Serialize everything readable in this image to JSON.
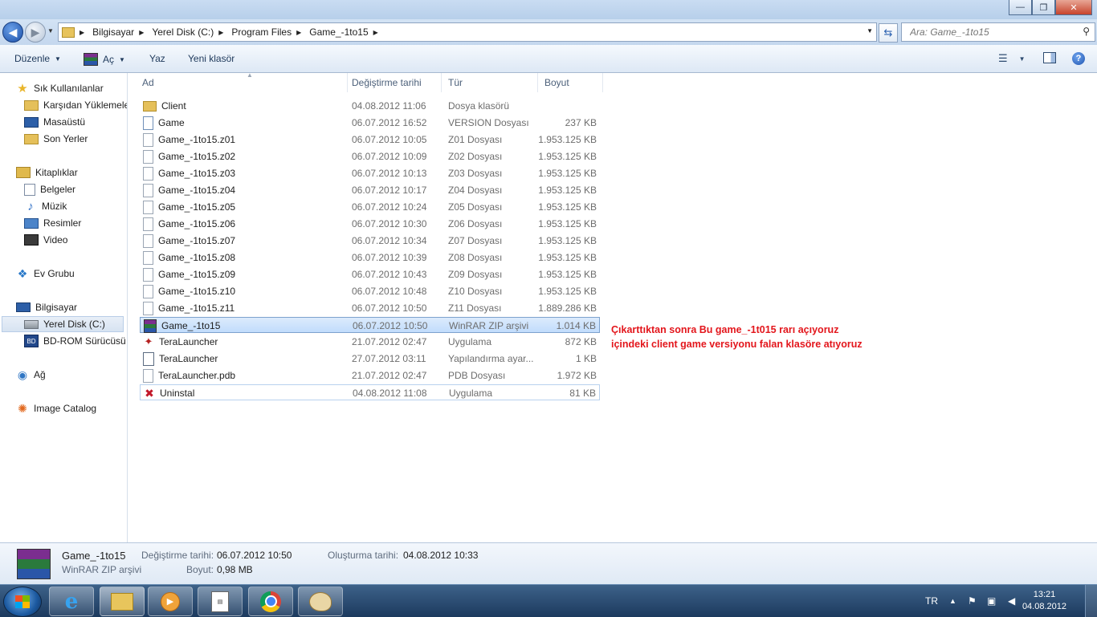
{
  "window": {
    "minimize": "—",
    "maximize": "❐",
    "close": "✕"
  },
  "address": {
    "crumbs": [
      "Bilgisayar",
      "Yerel Disk (C:)",
      "Program Files",
      "Game_-1to15"
    ],
    "search_placeholder": "Ara: Game_-1to15"
  },
  "toolbar": {
    "organize": "Düzenle",
    "open": "Aç",
    "burn": "Yaz",
    "new_folder": "Yeni klasör"
  },
  "nav": {
    "favorites": "Sık Kullanılanlar",
    "downloads": "Karşıdan Yüklemeler",
    "desktop": "Masaüstü",
    "recent": "Son Yerler",
    "libraries": "Kitaplıklar",
    "documents": "Belgeler",
    "music": "Müzik",
    "pictures": "Resimler",
    "videos": "Video",
    "homegroup": "Ev Grubu",
    "computer": "Bilgisayar",
    "local_disk": "Yerel Disk (C:)",
    "bd_rom": "BD-ROM Sürücüsü (",
    "network": "Ağ",
    "image_catalog": "Image Catalog"
  },
  "columns": {
    "name": "Ad",
    "date": "Değiştirme tarihi",
    "type": "Tür",
    "size": "Boyut"
  },
  "files": [
    {
      "name": "Client",
      "date": "04.08.2012 11:06",
      "type": "Dosya klasörü",
      "size": "",
      "icon": "folder-icon"
    },
    {
      "name": "Game",
      "date": "06.07.2012 16:52",
      "type": "VERSION Dosyası",
      "size": "237 KB",
      "icon": "version-file-icon"
    },
    {
      "name": "Game_-1to15.z01",
      "date": "06.07.2012 10:05",
      "type": "Z01 Dosyası",
      "size": "1.953.125 KB",
      "icon": "file-icon"
    },
    {
      "name": "Game_-1to15.z02",
      "date": "06.07.2012 10:09",
      "type": "Z02 Dosyası",
      "size": "1.953.125 KB",
      "icon": "file-icon"
    },
    {
      "name": "Game_-1to15.z03",
      "date": "06.07.2012 10:13",
      "type": "Z03 Dosyası",
      "size": "1.953.125 KB",
      "icon": "file-icon"
    },
    {
      "name": "Game_-1to15.z04",
      "date": "06.07.2012 10:17",
      "type": "Z04 Dosyası",
      "size": "1.953.125 KB",
      "icon": "file-icon"
    },
    {
      "name": "Game_-1to15.z05",
      "date": "06.07.2012 10:24",
      "type": "Z05 Dosyası",
      "size": "1.953.125 KB",
      "icon": "file-icon"
    },
    {
      "name": "Game_-1to15.z06",
      "date": "06.07.2012 10:30",
      "type": "Z06 Dosyası",
      "size": "1.953.125 KB",
      "icon": "file-icon"
    },
    {
      "name": "Game_-1to15.z07",
      "date": "06.07.2012 10:34",
      "type": "Z07 Dosyası",
      "size": "1.953.125 KB",
      "icon": "file-icon"
    },
    {
      "name": "Game_-1to15.z08",
      "date": "06.07.2012 10:39",
      "type": "Z08 Dosyası",
      "size": "1.953.125 KB",
      "icon": "file-icon"
    },
    {
      "name": "Game_-1to15.z09",
      "date": "06.07.2012 10:43",
      "type": "Z09 Dosyası",
      "size": "1.953.125 KB",
      "icon": "file-icon"
    },
    {
      "name": "Game_-1to15.z10",
      "date": "06.07.2012 10:48",
      "type": "Z10 Dosyası",
      "size": "1.953.125 KB",
      "icon": "file-icon"
    },
    {
      "name": "Game_-1to15.z11",
      "date": "06.07.2012 10:50",
      "type": "Z11 Dosyası",
      "size": "1.889.286 KB",
      "icon": "file-icon"
    },
    {
      "name": "Game_-1to15",
      "date": "06.07.2012 10:50",
      "type": "WinRAR ZIP arşivi",
      "size": "1.014 KB",
      "icon": "winrar-archive-icon"
    },
    {
      "name": "TeraLauncher",
      "date": "21.07.2012 02:47",
      "type": "Uygulama",
      "size": "872 KB",
      "icon": "launcher-app-icon"
    },
    {
      "name": "TeraLauncher",
      "date": "27.07.2012 03:11",
      "type": "Yapılandırma ayar...",
      "size": "1 KB",
      "icon": "config-file-icon"
    },
    {
      "name": "TeraLauncher.pdb",
      "date": "21.07.2012 02:47",
      "type": "PDB Dosyası",
      "size": "1.972 KB",
      "icon": "file-icon"
    },
    {
      "name": "Uninstal",
      "date": "04.08.2012 11:08",
      "type": "Uygulama",
      "size": "81 KB",
      "icon": "uninstall-app-icon"
    }
  ],
  "annotation": {
    "line1": "Çıkarttıktan sonra Bu game_-1t015 rarı açıyoruz",
    "line2": "içindeki client game versiyonu falan klasöre atıyoruz",
    "color": "#e3161c"
  },
  "details": {
    "name": "Game_-1to15",
    "type": "WinRAR ZIP arşivi",
    "modified_label": "Değiştirme tarihi:",
    "modified_value": "06.07.2012 10:50",
    "created_label": "Oluşturma tarihi:",
    "created_value": "04.08.2012 10:33",
    "size_label": "Boyut:",
    "size_value": "0,98 MB"
  },
  "taskbar": {
    "language": "TR",
    "time": "13:21",
    "date": "04.08.2012",
    "apps": [
      "internet-explorer-icon",
      "windows-explorer-icon",
      "media-player-icon",
      "document-icon",
      "chrome-icon",
      "paint-icon"
    ]
  }
}
